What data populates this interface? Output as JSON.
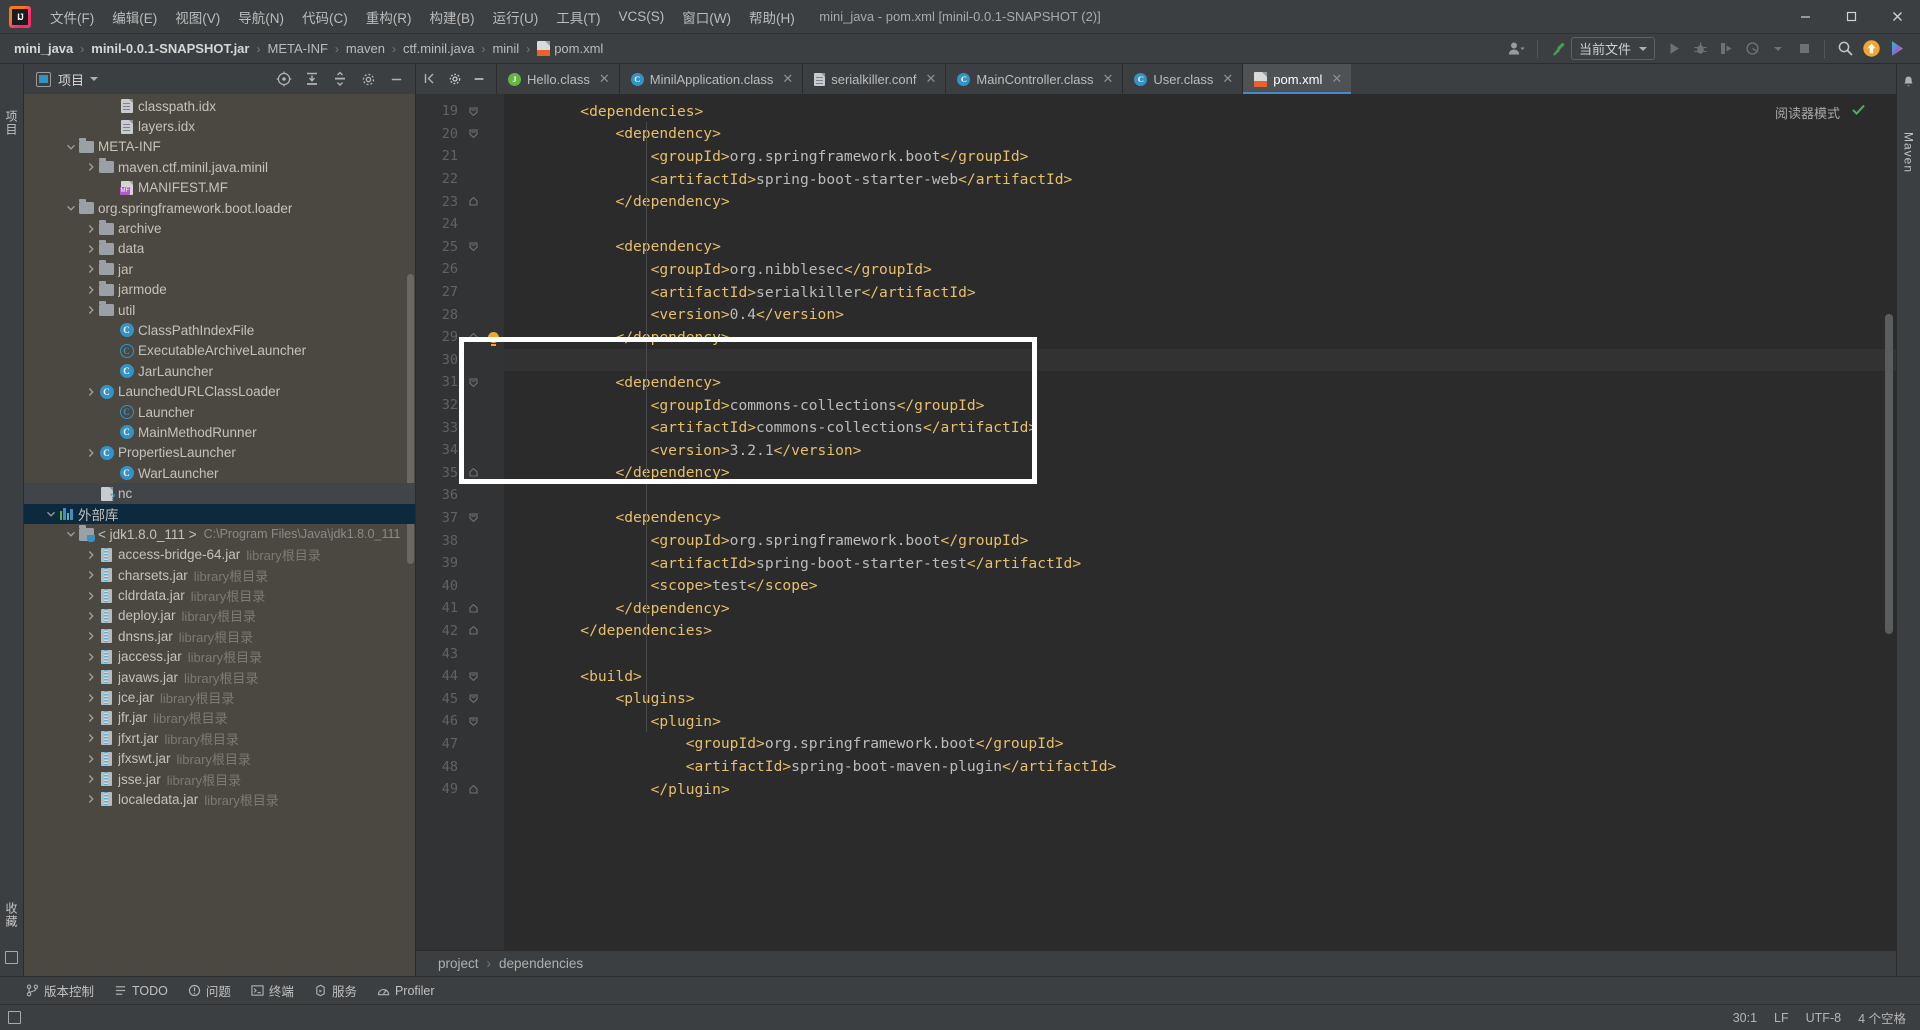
{
  "window": {
    "title": "mini_java - pom.xml [minil-0.0.1-SNAPSHOT (2)]",
    "minimize": "—",
    "maximize": "❐",
    "close": "✕"
  },
  "menubar": {
    "items": [
      {
        "label": "文件(F)",
        "name": "menu-file"
      },
      {
        "label": "编辑(E)",
        "name": "menu-edit"
      },
      {
        "label": "视图(V)",
        "name": "menu-view"
      },
      {
        "label": "导航(N)",
        "name": "menu-navigate"
      },
      {
        "label": "代码(C)",
        "name": "menu-code"
      },
      {
        "label": "重构(R)",
        "name": "menu-refactor"
      },
      {
        "label": "构建(B)",
        "name": "menu-build"
      },
      {
        "label": "运行(U)",
        "name": "menu-run"
      },
      {
        "label": "工具(T)",
        "name": "menu-tools"
      },
      {
        "label": "VCS(S)",
        "name": "menu-vcs"
      },
      {
        "label": "窗口(W)",
        "name": "menu-window"
      },
      {
        "label": "帮助(H)",
        "name": "menu-help"
      }
    ]
  },
  "breadcrumb": {
    "items": [
      {
        "label": "mini_java",
        "bold": true,
        "icon": ""
      },
      {
        "label": "minil-0.0.1-SNAPSHOT.jar",
        "bold": true,
        "icon": ""
      },
      {
        "label": "META-INF",
        "bold": false,
        "icon": ""
      },
      {
        "label": "maven",
        "bold": false,
        "icon": ""
      },
      {
        "label": "ctf.minil.java",
        "bold": false,
        "icon": ""
      },
      {
        "label": "minil",
        "bold": false,
        "icon": ""
      },
      {
        "label": "pom.xml",
        "bold": false,
        "icon": "xml-file-icon"
      }
    ],
    "separator": "›"
  },
  "toolbar": {
    "run_config": "当前文件",
    "run_tooltip": "运行",
    "debug_tooltip": "调试",
    "search_tooltip": "搜索",
    "update_tooltip": "更新项目",
    "ai_tooltip": "AI 助手"
  },
  "project_panel": {
    "title": "项目",
    "tree": [
      {
        "indent": 4,
        "twisty": "none",
        "icon": "idx-file-icon",
        "label": "classpath.idx",
        "sub": "",
        "state": "none"
      },
      {
        "indent": 4,
        "twisty": "none",
        "icon": "idx-file-icon",
        "label": "layers.idx",
        "sub": "",
        "state": "none"
      },
      {
        "indent": 2,
        "twisty": "open",
        "icon": "folder-icon",
        "label": "META-INF",
        "sub": "",
        "state": "none"
      },
      {
        "indent": 3,
        "twisty": "closed",
        "icon": "folder-icon",
        "label": "maven.ctf.minil.java.minil",
        "sub": "",
        "state": "none"
      },
      {
        "indent": 4,
        "twisty": "none",
        "icon": "manifest-icon",
        "label": "MANIFEST.MF",
        "sub": "",
        "state": "none"
      },
      {
        "indent": 2,
        "twisty": "open",
        "icon": "folder-icon",
        "label": "org.springframework.boot.loader",
        "sub": "",
        "state": "none"
      },
      {
        "indent": 3,
        "twisty": "closed",
        "icon": "folder-icon",
        "label": "archive",
        "sub": "",
        "state": "none"
      },
      {
        "indent": 3,
        "twisty": "closed",
        "icon": "folder-icon",
        "label": "data",
        "sub": "",
        "state": "none"
      },
      {
        "indent": 3,
        "twisty": "closed",
        "icon": "folder-icon",
        "label": "jar",
        "sub": "",
        "state": "none"
      },
      {
        "indent": 3,
        "twisty": "closed",
        "icon": "folder-icon",
        "label": "jarmode",
        "sub": "",
        "state": "none"
      },
      {
        "indent": 3,
        "twisty": "closed",
        "icon": "folder-icon",
        "label": "util",
        "sub": "",
        "state": "none"
      },
      {
        "indent": 4,
        "twisty": "none",
        "icon": "class-icon",
        "label": "ClassPathIndexFile",
        "sub": "",
        "state": "none"
      },
      {
        "indent": 4,
        "twisty": "none",
        "icon": "abstract-class-icon",
        "label": "ExecutableArchiveLauncher",
        "sub": "",
        "state": "none"
      },
      {
        "indent": 4,
        "twisty": "none",
        "icon": "class-icon",
        "label": "JarLauncher",
        "sub": "",
        "state": "none"
      },
      {
        "indent": 3,
        "twisty": "closed",
        "icon": "class-icon",
        "label": "LaunchedURLClassLoader",
        "sub": "",
        "state": "none"
      },
      {
        "indent": 4,
        "twisty": "none",
        "icon": "abstract-class-icon",
        "label": "Launcher",
        "sub": "",
        "state": "none"
      },
      {
        "indent": 4,
        "twisty": "none",
        "icon": "class-icon",
        "label": "MainMethodRunner",
        "sub": "",
        "state": "none"
      },
      {
        "indent": 3,
        "twisty": "closed",
        "icon": "class-icon",
        "label": "PropertiesLauncher",
        "sub": "",
        "state": "none"
      },
      {
        "indent": 4,
        "twisty": "none",
        "icon": "class-icon",
        "label": "WarLauncher",
        "sub": "",
        "state": "none"
      },
      {
        "indent": 3,
        "twisty": "none",
        "icon": "unknown-file-icon",
        "label": "nc",
        "sub": "",
        "state": "grey"
      },
      {
        "indent": 1,
        "twisty": "open",
        "icon": "external-libraries-icon",
        "label": "外部库",
        "sub": "",
        "state": "blue"
      },
      {
        "indent": 2,
        "twisty": "open",
        "icon": "jdk-icon",
        "label": "< jdk1.8.0_111 >",
        "sub": "C:\\Program Files\\Java\\jdk1.8.0_111",
        "state": "none"
      },
      {
        "indent": 3,
        "twisty": "closed",
        "icon": "jar-icon",
        "label": "access-bridge-64.jar",
        "sub": "library根目录",
        "state": "none"
      },
      {
        "indent": 3,
        "twisty": "closed",
        "icon": "jar-icon",
        "label": "charsets.jar",
        "sub": "library根目录",
        "state": "none"
      },
      {
        "indent": 3,
        "twisty": "closed",
        "icon": "jar-icon",
        "label": "cldrdata.jar",
        "sub": "library根目录",
        "state": "none"
      },
      {
        "indent": 3,
        "twisty": "closed",
        "icon": "jar-icon",
        "label": "deploy.jar",
        "sub": "library根目录",
        "state": "none"
      },
      {
        "indent": 3,
        "twisty": "closed",
        "icon": "jar-icon",
        "label": "dnsns.jar",
        "sub": "library根目录",
        "state": "none"
      },
      {
        "indent": 3,
        "twisty": "closed",
        "icon": "jar-icon",
        "label": "jaccess.jar",
        "sub": "library根目录",
        "state": "none"
      },
      {
        "indent": 3,
        "twisty": "closed",
        "icon": "jar-icon",
        "label": "javaws.jar",
        "sub": "library根目录",
        "state": "none"
      },
      {
        "indent": 3,
        "twisty": "closed",
        "icon": "jar-icon",
        "label": "jce.jar",
        "sub": "library根目录",
        "state": "none"
      },
      {
        "indent": 3,
        "twisty": "closed",
        "icon": "jar-icon",
        "label": "jfr.jar",
        "sub": "library根目录",
        "state": "none"
      },
      {
        "indent": 3,
        "twisty": "closed",
        "icon": "jar-icon",
        "label": "jfxrt.jar",
        "sub": "library根目录",
        "state": "none"
      },
      {
        "indent": 3,
        "twisty": "closed",
        "icon": "jar-icon",
        "label": "jfxswt.jar",
        "sub": "library根目录",
        "state": "none"
      },
      {
        "indent": 3,
        "twisty": "closed",
        "icon": "jar-icon",
        "label": "jsse.jar",
        "sub": "library根目录",
        "state": "none"
      },
      {
        "indent": 3,
        "twisty": "closed",
        "icon": "jar-icon",
        "label": "localedata.jar",
        "sub": "library根目录",
        "state": "none"
      }
    ]
  },
  "rail": {
    "left_top": "项目",
    "left_bottom": "收藏",
    "right_top": "通知",
    "right_bottom": "Maven"
  },
  "editor_tabs": [
    {
      "label": "Hello.class",
      "icon": "java-class-green-icon",
      "active": false,
      "close": "✕"
    },
    {
      "label": "MinilApplication.class",
      "icon": "java-class-icon",
      "active": false,
      "close": "✕"
    },
    {
      "label": "serialkiller.conf",
      "icon": "config-file-icon",
      "active": false,
      "close": "✕"
    },
    {
      "label": "MainController.class",
      "icon": "java-class-icon",
      "active": false,
      "close": "✕"
    },
    {
      "label": "User.class",
      "icon": "java-class-icon",
      "active": false,
      "close": "✕"
    },
    {
      "label": "pom.xml",
      "icon": "maven-xml-icon",
      "active": true,
      "close": "✕"
    }
  ],
  "editor": {
    "reader_mode": "阅读器模式",
    "lines": [
      {
        "n": 19,
        "fold": "start",
        "indent": 2,
        "text": "<dependencies>",
        "bulb": false
      },
      {
        "n": 20,
        "fold": "start",
        "indent": 3,
        "text": "<dependency>",
        "bulb": false
      },
      {
        "n": 21,
        "fold": "none",
        "indent": 4,
        "text": "<groupId>org.springframework.boot</groupId>",
        "bulb": false
      },
      {
        "n": 22,
        "fold": "none",
        "indent": 4,
        "text": "<artifactId>spring-boot-starter-web</artifactId>",
        "bulb": false
      },
      {
        "n": 23,
        "fold": "end",
        "indent": 3,
        "text": "</dependency>",
        "bulb": false
      },
      {
        "n": 24,
        "fold": "none",
        "indent": 0,
        "text": "",
        "bulb": false
      },
      {
        "n": 25,
        "fold": "start",
        "indent": 3,
        "text": "<dependency>",
        "bulb": false
      },
      {
        "n": 26,
        "fold": "none",
        "indent": 4,
        "text": "<groupId>org.nibblesec</groupId>",
        "bulb": false
      },
      {
        "n": 27,
        "fold": "none",
        "indent": 4,
        "text": "<artifactId>serialkiller</artifactId>",
        "bulb": false
      },
      {
        "n": 28,
        "fold": "none",
        "indent": 4,
        "text": "<version>0.4</version>",
        "bulb": false
      },
      {
        "n": 29,
        "fold": "end",
        "indent": 3,
        "text": "</dependency>",
        "bulb": true
      },
      {
        "n": 30,
        "fold": "none",
        "indent": 0,
        "text": "",
        "bulb": false,
        "current": true
      },
      {
        "n": 31,
        "fold": "start",
        "indent": 3,
        "text": "<dependency>",
        "bulb": false
      },
      {
        "n": 32,
        "fold": "none",
        "indent": 4,
        "text": "<groupId>commons-collections</groupId>",
        "bulb": false
      },
      {
        "n": 33,
        "fold": "none",
        "indent": 4,
        "text": "<artifactId>commons-collections</artifactId>",
        "bulb": false
      },
      {
        "n": 34,
        "fold": "none",
        "indent": 4,
        "text": "<version>3.2.1</version>",
        "bulb": false
      },
      {
        "n": 35,
        "fold": "end",
        "indent": 3,
        "text": "</dependency>",
        "bulb": false
      },
      {
        "n": 36,
        "fold": "none",
        "indent": 0,
        "text": "",
        "bulb": false
      },
      {
        "n": 37,
        "fold": "start",
        "indent": 3,
        "text": "<dependency>",
        "bulb": false
      },
      {
        "n": 38,
        "fold": "none",
        "indent": 4,
        "text": "<groupId>org.springframework.boot</groupId>",
        "bulb": false
      },
      {
        "n": 39,
        "fold": "none",
        "indent": 4,
        "text": "<artifactId>spring-boot-starter-test</artifactId>",
        "bulb": false
      },
      {
        "n": 40,
        "fold": "none",
        "indent": 4,
        "text": "<scope>test</scope>",
        "bulb": false
      },
      {
        "n": 41,
        "fold": "end",
        "indent": 3,
        "text": "</dependency>",
        "bulb": false
      },
      {
        "n": 42,
        "fold": "end",
        "indent": 2,
        "text": "</dependencies>",
        "bulb": false
      },
      {
        "n": 43,
        "fold": "none",
        "indent": 0,
        "text": "",
        "bulb": false
      },
      {
        "n": 44,
        "fold": "start",
        "indent": 2,
        "text": "<build>",
        "bulb": false
      },
      {
        "n": 45,
        "fold": "start",
        "indent": 3,
        "text": "<plugins>",
        "bulb": false
      },
      {
        "n": 46,
        "fold": "start",
        "indent": 4,
        "text": "<plugin>",
        "bulb": false
      },
      {
        "n": 47,
        "fold": "none",
        "indent": 5,
        "text": "<groupId>org.springframework.boot</groupId>",
        "bulb": false
      },
      {
        "n": 48,
        "fold": "none",
        "indent": 5,
        "text": "<artifactId>spring-boot-maven-plugin</artifactId>",
        "bulb": false
      },
      {
        "n": 49,
        "fold": "end",
        "indent": 4,
        "text": "</plugin>",
        "bulb": false
      }
    ],
    "bottom_breadcrumb": [
      "project",
      "dependencies"
    ],
    "bottom_breadcrumb_sep": "›"
  },
  "bottom_tools": [
    {
      "label": "版本控制",
      "icon": "vcs-icon"
    },
    {
      "label": "TODO",
      "icon": "todo-icon"
    },
    {
      "label": "问题",
      "icon": "problems-icon"
    },
    {
      "label": "终端",
      "icon": "terminal-icon"
    },
    {
      "label": "服务",
      "icon": "services-icon"
    },
    {
      "label": "Profiler",
      "icon": "profiler-icon"
    }
  ],
  "statusbar": {
    "caret": "30:1",
    "line_sep": "LF",
    "encoding": "UTF-8",
    "indent": "4 个空格"
  },
  "colors": {
    "accent_blue": "#3592c4",
    "tag_orange": "#e8bf6a",
    "text_code": "#a9b7c6",
    "panel_bg": "#3c3f41",
    "tree_bg": "#4b4841",
    "editor_bg": "#2b2b2b",
    "selection_blue": "#0d293e",
    "bulb_yellow": "#f0a732",
    "annotation_white": "#ffffff"
  }
}
